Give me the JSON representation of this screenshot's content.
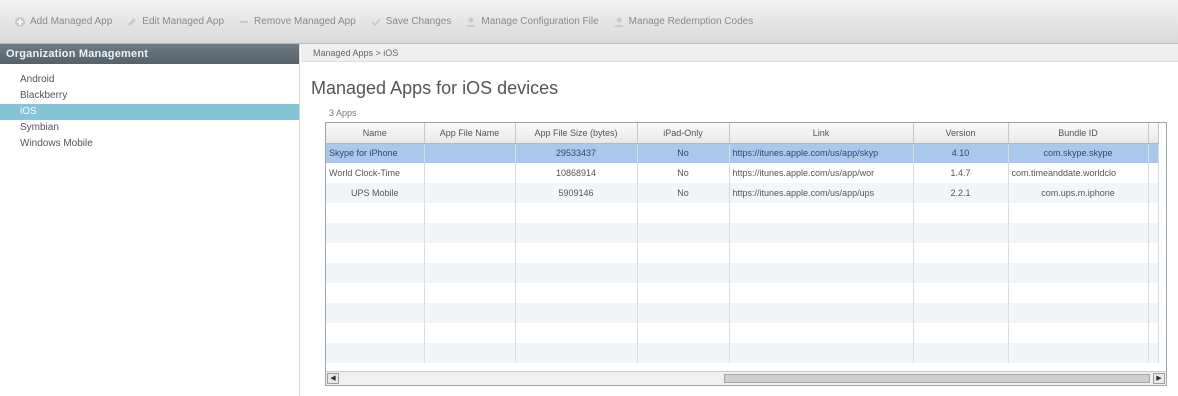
{
  "toolbar": {
    "buttons": [
      {
        "label": "Add Managed App",
        "icon": "plus-icon"
      },
      {
        "label": "Edit Managed App",
        "icon": "pencil-icon"
      },
      {
        "label": "Remove Managed App",
        "icon": "minus-icon"
      },
      {
        "label": "Save Changes",
        "icon": "check-icon"
      },
      {
        "label": "Manage Configuration File",
        "icon": "person-icon"
      },
      {
        "label": "Manage Redemption Codes",
        "icon": "person-icon"
      }
    ]
  },
  "sidebar": {
    "header": "Organization Management",
    "items": [
      {
        "label": "Android"
      },
      {
        "label": "Blackberry"
      },
      {
        "label": "iOS"
      },
      {
        "label": "Symbian"
      },
      {
        "label": "Windows Mobile"
      }
    ],
    "active_index": 2
  },
  "main": {
    "breadcrumb": "Managed Apps > iOS",
    "title": "Managed Apps for iOS devices",
    "count": "3 Apps",
    "columns": [
      "Name",
      "App File Name",
      "App File Size (bytes)",
      "iPad-Only",
      "Link",
      "Version",
      "Bundle ID",
      ""
    ],
    "rows": [
      {
        "name": "Skype for iPhone",
        "file_name": "",
        "size": "29533437",
        "ipad_only": "No",
        "link": "https://itunes.apple.com/us/app/skyp",
        "version": "4.10",
        "bundle_id": "com.skype.skype"
      },
      {
        "name": "World Clock-Time",
        "file_name": "",
        "size": "10868914",
        "ipad_only": "No",
        "link": "https://itunes.apple.com/us/app/wor",
        "version": "1.4.7",
        "bundle_id": "com.timeanddate.worldclo"
      },
      {
        "name": "UPS Mobile",
        "file_name": "",
        "size": "5909146",
        "ipad_only": "No",
        "link": "https://itunes.apple.com/us/app/ups",
        "version": "2.2.1",
        "bundle_id": "com.ups.m.iphone"
      }
    ],
    "selected_row": 0
  },
  "colors": {
    "selection": "#a9c8ec",
    "sidebar_active": "#86c3d6",
    "sidebar_header": "#616b74"
  }
}
